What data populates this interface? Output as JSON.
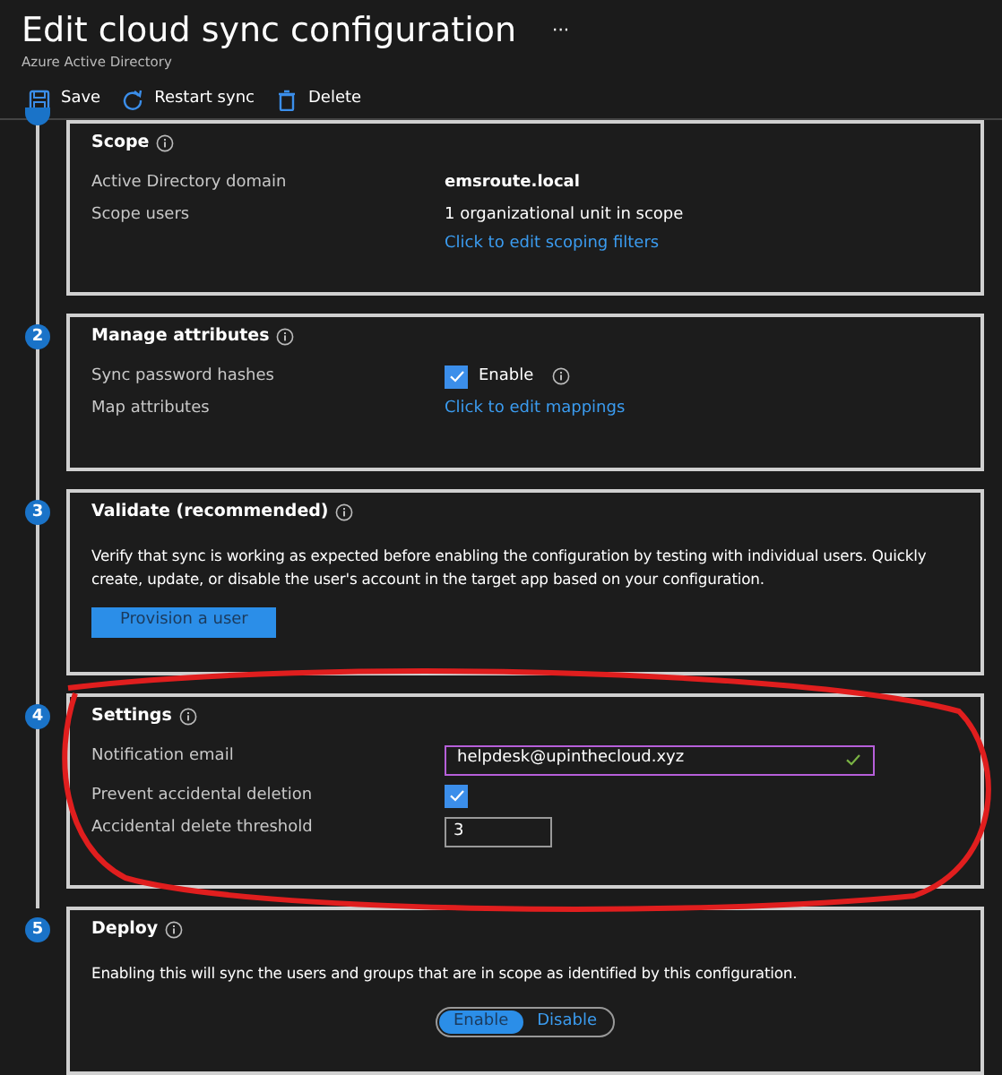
{
  "header": {
    "title": "Edit cloud sync configuration",
    "more": "···",
    "subtitle": "Azure Active Directory"
  },
  "toolbar": [
    {
      "kind": "save",
      "label": "Save"
    },
    {
      "kind": "restart",
      "label": "Restart sync"
    },
    {
      "kind": "delete",
      "label": "Delete"
    }
  ],
  "sections": [
    {
      "title": "Scope",
      "rows": [
        {
          "label": "Active Directory domain",
          "controls": [
            {
              "kind": "strong",
              "text": "emsroute.local"
            }
          ]
        },
        {
          "label": "Scope users",
          "controls": [
            {
              "kind": "text",
              "text": "1 organizational unit in scope"
            },
            {
              "kind": "link",
              "text": "Click to edit scoping filters"
            }
          ]
        }
      ]
    },
    {
      "step": "2",
      "title": "Manage attributes",
      "rows": [
        {
          "label": "Sync password hashes",
          "controls": [
            {
              "kind": "checkbox",
              "checked": true,
              "text": "Enable",
              "info": true
            }
          ]
        },
        {
          "label": "Map attributes",
          "controls": [
            {
              "kind": "link",
              "text": "Click to edit mappings"
            }
          ]
        }
      ]
    },
    {
      "step": "3",
      "title": "Validate (recommended)",
      "description": "Verify that sync is working as expected before enabling the configuration by testing with individual users. Quickly create, update, or disable the user's account in the target app based on your configuration.",
      "button": "Provision a user"
    },
    {
      "step": "4",
      "title": "Settings",
      "rows": [
        {
          "label": "Notification email",
          "controls": [
            {
              "kind": "input",
              "value": "helpdesk@upinthecloud.xyz",
              "valid": true,
              "focused": true
            }
          ]
        },
        {
          "label": "Prevent accidental deletion",
          "controls": [
            {
              "kind": "checkbox",
              "checked": true
            }
          ]
        },
        {
          "label": "Accidental delete threshold",
          "controls": [
            {
              "kind": "number",
              "value": "3"
            }
          ]
        }
      ]
    },
    {
      "step": "5",
      "title": "Deploy",
      "description": "Enabling this will sync the users and groups that are in scope as identified by this configuration.",
      "toggle": [
        {
          "label": "Enable",
          "selected": true
        },
        {
          "label": "Disable",
          "selected": false
        }
      ]
    }
  ]
}
